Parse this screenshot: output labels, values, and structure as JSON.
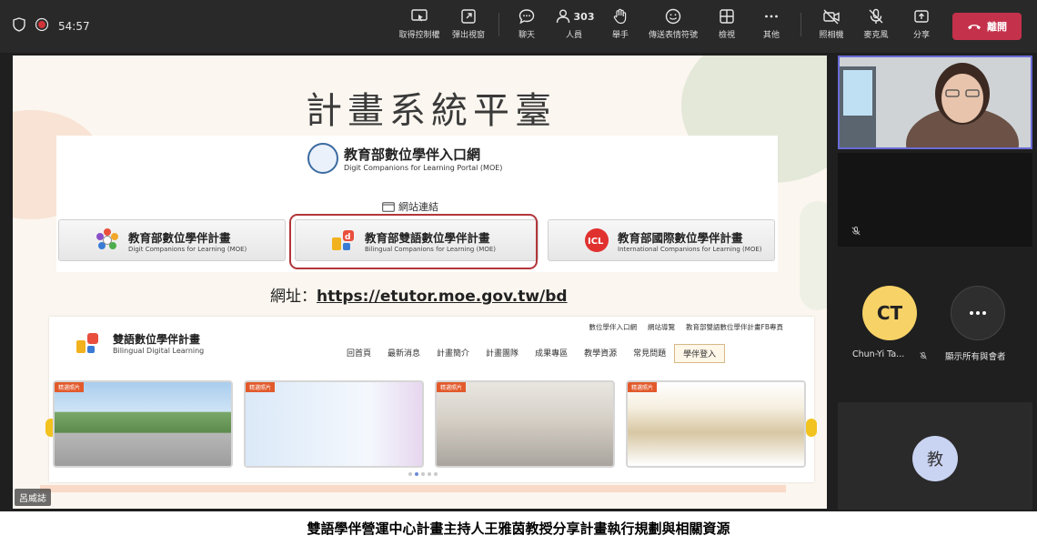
{
  "topbar": {
    "timer": "54:57",
    "buttons": {
      "take_control": "取得控制權",
      "pop_out": "彈出視窗",
      "chat": "聊天",
      "people": "人員",
      "people_count": "303",
      "raise_hand": "舉手",
      "reactions": "傳送表情符號",
      "view": "檢視",
      "more": "其他",
      "camera": "照相機",
      "mic": "麥克風",
      "share": "分享",
      "leave": "離開"
    }
  },
  "slide": {
    "title": "計畫系統平臺",
    "portal_title": "教育部數位學伴入口網",
    "portal_subtitle": "Digit Companions for Learning Portal (MOE)",
    "link_caption": "網站連結",
    "projects": [
      {
        "name": "教育部數位學伴計畫",
        "en": "Digit Companions for Learning (MOE)"
      },
      {
        "name": "教育部雙語數位學伴計畫",
        "en": "Bilingual Companions for Learning (MOE)"
      },
      {
        "name": "教育部國際數位學伴計畫",
        "en": "International Companions for Learning (MOE)"
      }
    ],
    "url_label": "網址：",
    "url": "https://etutor.moe.gov.tw/bd",
    "site": {
      "brand_title": "雙語數位學伴計畫",
      "brand_subtitle": "Bilingual Digital Learning",
      "top_links": [
        "數位學伴入口網",
        "網站導覽",
        "教育部雙語數位學伴計畫FB專頁"
      ],
      "nav": [
        "回首頁",
        "最新消息",
        "計畫簡介",
        "計畫團隊",
        "成果專區",
        "教學資源",
        "常見問題",
        "學伴登入"
      ],
      "thumb_tag": "精選照片"
    },
    "presenter_name": "呂威誌"
  },
  "participants": {
    "ct_initials": "CT",
    "ct_name": "Chun-Yi Ta...",
    "show_all": "顯示所有與會者",
    "self_initial": "教"
  },
  "caption": "雙語學伴營運中心計畫主持人王雅茵教授分享計畫執行規劃與相關資源",
  "colors": {
    "leave": "#c4314b",
    "highlight": "#b2363a",
    "ct_avatar": "#f7d267",
    "active_border": "#6b6bd6"
  }
}
